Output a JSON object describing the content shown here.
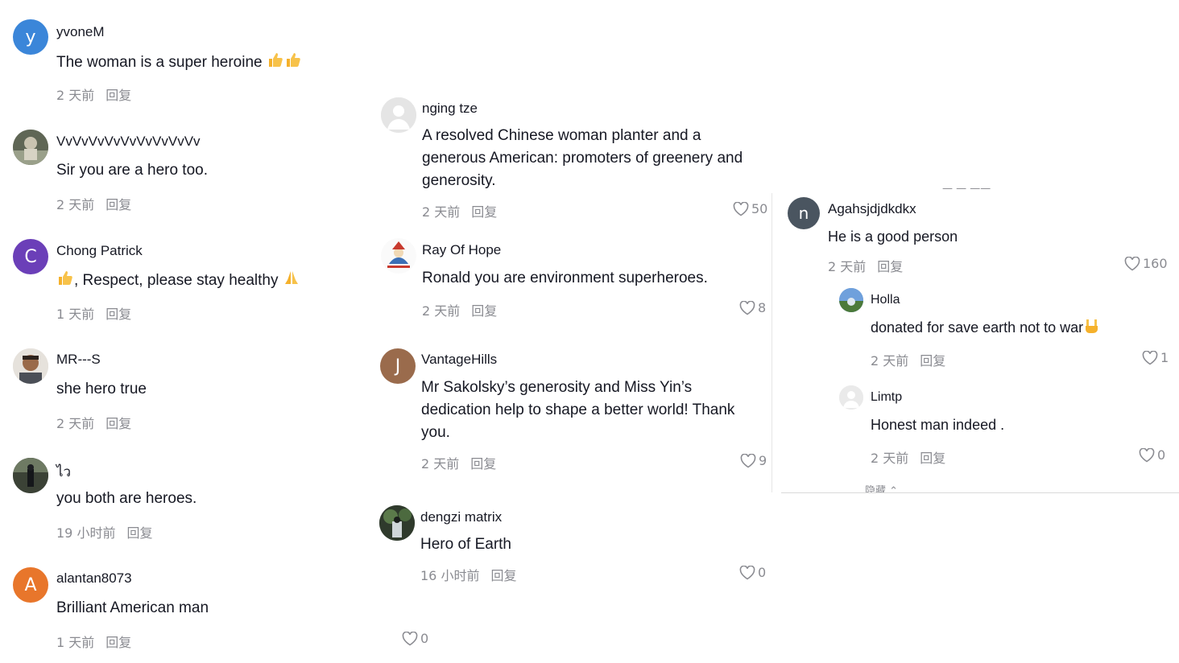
{
  "reply_label": "回复",
  "col1": [
    {
      "name": "yvoneM",
      "text": "The woman is a super heroine",
      "time": "2 天前",
      "initial": "y",
      "color": "#3b86d9"
    },
    {
      "name": "VvVvVvVvVvVvVvVvVv",
      "text": "Sir you are a hero too.",
      "time": "2 天前"
    },
    {
      "name": "Chong Patrick",
      "text": ", Respect, please stay healthy",
      "time": "1 天前",
      "initial": "C",
      "color": "#6b3fb8"
    },
    {
      "name": "MR---S",
      "text": "she hero true",
      "time": "2 天前"
    },
    {
      "name": "ไว",
      "text": "you both are heroes.",
      "time": "19 小时前"
    },
    {
      "name": "alantan8073",
      "text": "Brilliant American man",
      "time": "1 天前",
      "initial": "A",
      "color": "#e8762b"
    }
  ],
  "col2": [
    {
      "name": "nging tze",
      "text": "A resolved Chinese woman planter and a generous American: promoters of greenery and generosity.",
      "time": "2 天前",
      "likes": "50"
    },
    {
      "name": "Ray Of Hope",
      "text": "Ronald you are environment superheroes.",
      "time": "2 天前",
      "likes": "8"
    },
    {
      "name": "VantageHills",
      "text": "Mr Sakolsky’s generosity and Miss Yin’s dedication help to shape a better world! Thank you.",
      "time": "2 天前",
      "likes": "9",
      "initial": "J",
      "color": "#9a6b4c"
    },
    {
      "name": "dengzi matrix",
      "text": "Hero of Earth",
      "time": "16 小时前",
      "likes": "0"
    }
  ],
  "col3": [
    {
      "name": "Agahsjdjdkdkx",
      "text": "He is a good person",
      "time": "2 天前",
      "likes": "160",
      "initial": "n",
      "color": "#4a5560"
    },
    {
      "name": "Holla",
      "text": "donated for save earth not to war",
      "time": "2 天前",
      "likes": "1"
    },
    {
      "name": "Limtp",
      "text": "Honest man indeed .",
      "time": "2 天前",
      "likes": "0"
    }
  ],
  "bottom_like": "0",
  "hidden_label": "隐藏"
}
